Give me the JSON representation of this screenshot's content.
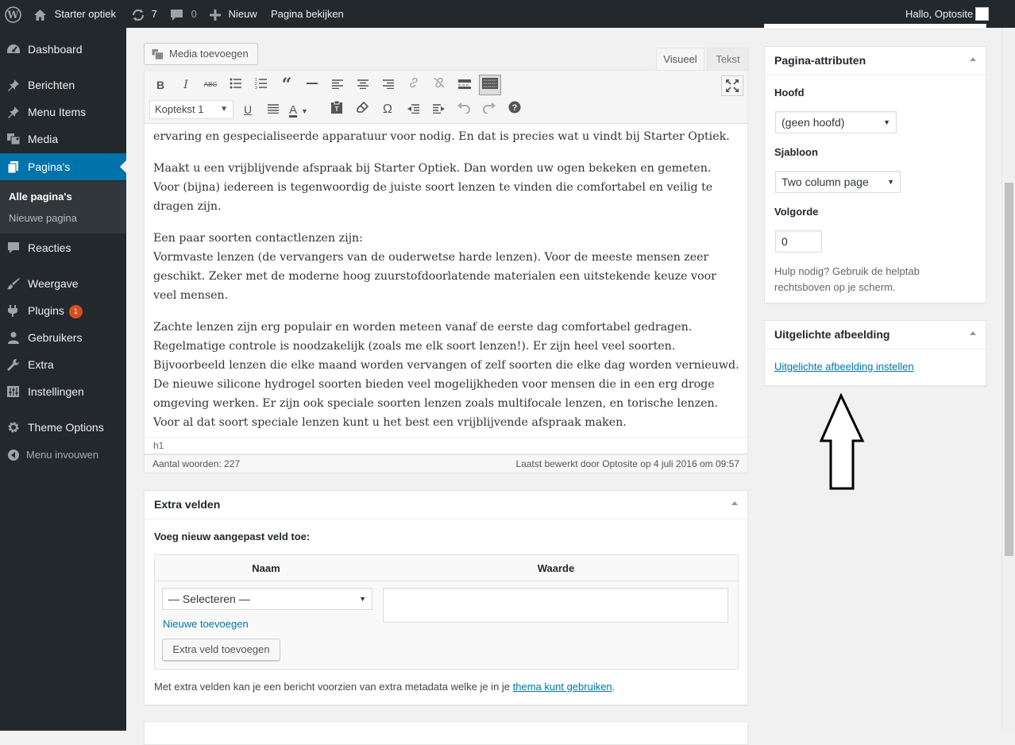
{
  "adminbar": {
    "site": "Starter optiek",
    "updates": "7",
    "comments": "0",
    "new": "Nieuw",
    "view": "Pagina bekijken",
    "greeting": "Hallo, Optosite"
  },
  "menu": {
    "dashboard": "Dashboard",
    "posts": "Berichten",
    "menu_items": "Menu Items",
    "media": "Media",
    "pages": "Pagina's",
    "all_pages": "Alle pagina's",
    "new_page": "Nieuwe pagina",
    "comments": "Reacties",
    "appearance": "Weergave",
    "plugins": "Plugins",
    "plugins_badge": "1",
    "users": "Gebruikers",
    "tools": "Extra",
    "settings": "Instellingen",
    "theme_options": "Theme Options",
    "collapse": "Menu invouwen"
  },
  "editor": {
    "media_button": "Media toevoegen",
    "tab_visual": "Visueel",
    "tab_text": "Tekst",
    "format_select": "Koptekst 1",
    "paragraphs": [
      "ervaring en gespecialiseerde apparatuur voor nodig. En dat is precies wat u vindt bij Starter Optiek.",
      "Maakt u een vrijblijvende afspraak bij Starter Optiek. Dan worden uw ogen bekeken en gemeten. Voor (bijna) iedereen is tegenwoordig de juiste soort lenzen te vinden die comfortabel en veilig te dragen zijn.",
      "Een paar soorten contactlenzen zijn:",
      "Vormvaste lenzen (de vervangers van de ouderwetse harde lenzen). Voor de meeste mensen zeer geschikt. Zeker met de moderne hoog zuurstofdoorlatende materialen een uitstekende keuze voor veel mensen.",
      "Zachte lenzen zijn erg populair en worden meteen vanaf de eerste dag comfortabel gedragen. Regelmatige controle is noodzakelijk (zoals me elk soort lenzen!). Er zijn heel veel soorten. Bijvoorbeeld lenzen die elke maand worden vervangen of zelf soorten die elke dag worden vernieuwd. De nieuwe silicone hydrogel soorten bieden veel mogelijkheden voor mensen die in een erg droge omgeving werken. Er zijn ook speciale soorten lenzen zoals multifocale lenzen, en torische lenzen. Voor al dat soort speciale lenzen kunt u het best een vrijblijvende afspraak maken."
    ],
    "path": "h1",
    "word_count": "Aantal woorden: 227",
    "last_edited": "Laatst bewerkt door Optosite op 4 juli 2016 om 09:57"
  },
  "custom_fields": {
    "title": "Extra velden",
    "add_label": "Voeg nieuw aangepast veld toe:",
    "col_name": "Naam",
    "col_value": "Waarde",
    "select_placeholder": "— Selecteren —",
    "new_link": "Nieuwe toevoegen",
    "add_button": "Extra veld toevoegen",
    "note_pre": "Met extra velden kan je een bericht voorzien van extra metadata welke je in je ",
    "note_link": "thema kunt gebruiken",
    "note_post": "."
  },
  "attributes": {
    "title": "Pagina-attributen",
    "parent_label": "Hoofd",
    "parent_value": "(geen hoofd)",
    "template_label": "Sjabloon",
    "template_value": "Two column page",
    "order_label": "Volgorde",
    "order_value": "0",
    "help": "Hulp nodig? Gebruik de helptab rechtsboven op je scherm."
  },
  "featured": {
    "title": "Uitgelichte afbeelding",
    "link": "Uitgelichte afbeelding instellen"
  },
  "colors": {
    "adminbar": "#23282d",
    "active_menu": "#0073aa",
    "badge": "#d54e21",
    "link": "#0073aa"
  }
}
